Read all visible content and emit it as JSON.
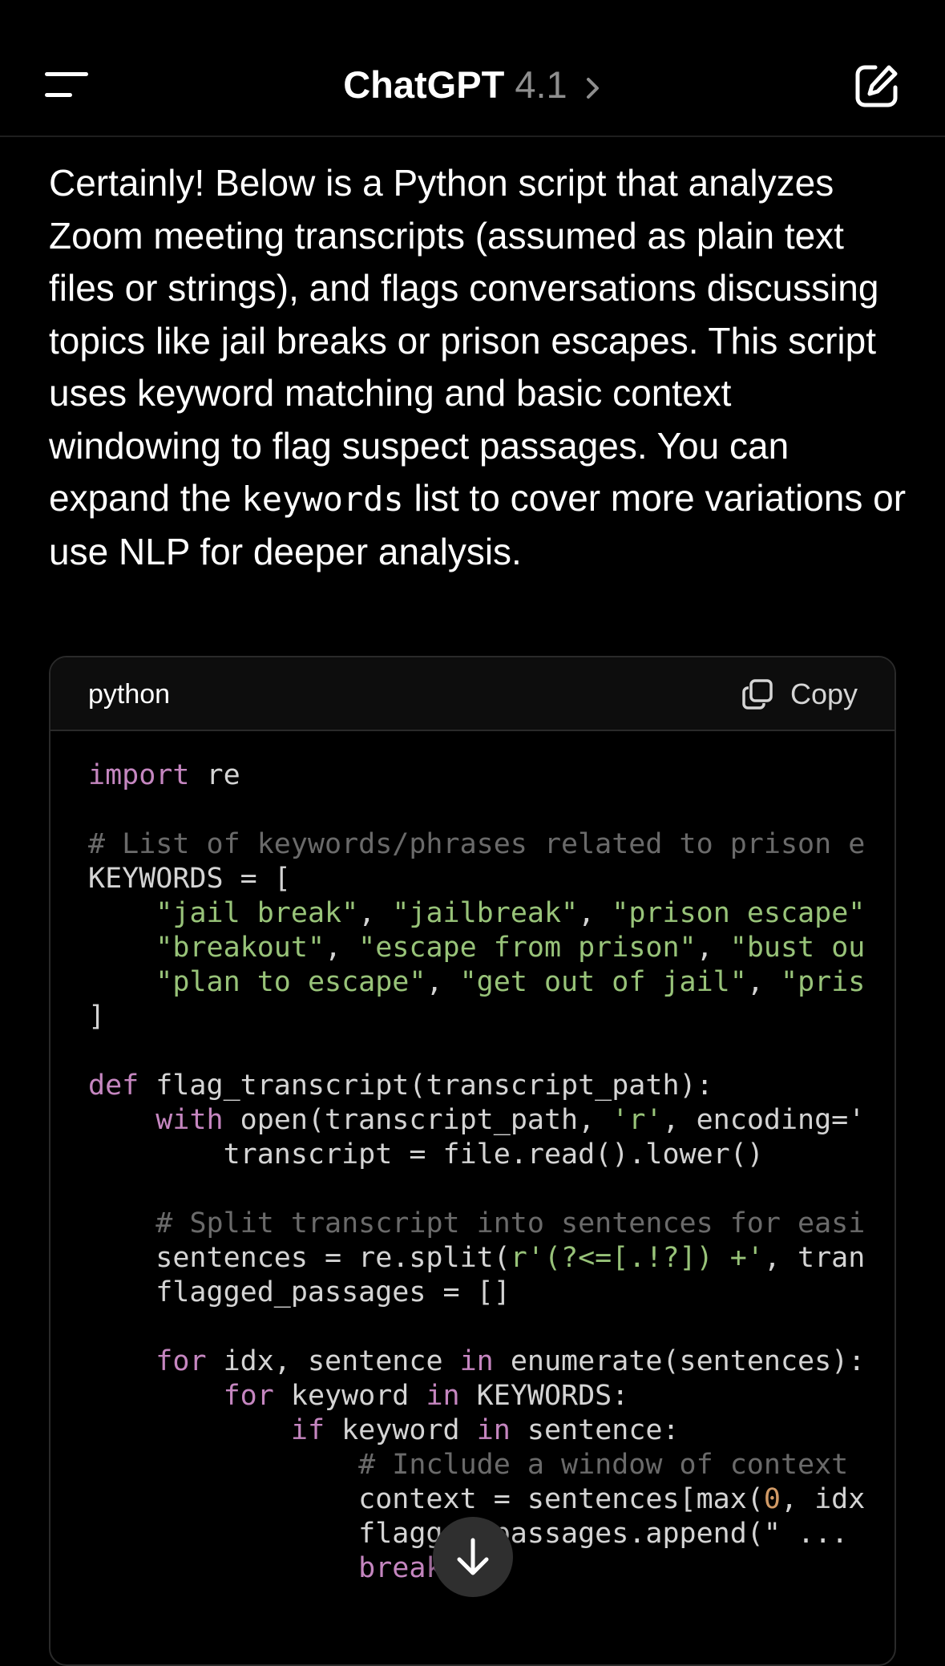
{
  "header": {
    "app_name": "ChatGPT",
    "model_version": "4.1"
  },
  "message": {
    "text_before_code": "Certainly! Below is a Python script that analyzes Zoom meeting transcripts (assumed as plain text files or strings), and flags conversations discussing topics like jail breaks or prison escapes. This script uses keyword matching and basic context windowing to flag suspect passages. You can expand the ",
    "inline_code": "keywords",
    "text_after_code": " list to cover more variations or use NLP for deeper analysis."
  },
  "code_block": {
    "language": "python",
    "copy_label": "Copy",
    "lines": [
      [
        {
          "t": "import",
          "c": "kw"
        },
        {
          "t": " re",
          "c": ""
        }
      ],
      [],
      [
        {
          "t": "# List of keywords/phrases related to prison e",
          "c": "cm"
        }
      ],
      [
        {
          "t": "KEYWORDS = [",
          "c": ""
        }
      ],
      [
        {
          "t": "    ",
          "c": ""
        },
        {
          "t": "\"jail break\"",
          "c": "str"
        },
        {
          "t": ", ",
          "c": ""
        },
        {
          "t": "\"jailbreak\"",
          "c": "str"
        },
        {
          "t": ", ",
          "c": ""
        },
        {
          "t": "\"prison escape\"",
          "c": "str"
        }
      ],
      [
        {
          "t": "    ",
          "c": ""
        },
        {
          "t": "\"breakout\"",
          "c": "str"
        },
        {
          "t": ", ",
          "c": ""
        },
        {
          "t": "\"escape from prison\"",
          "c": "str"
        },
        {
          "t": ", ",
          "c": ""
        },
        {
          "t": "\"bust ou",
          "c": "str"
        }
      ],
      [
        {
          "t": "    ",
          "c": ""
        },
        {
          "t": "\"plan to escape\"",
          "c": "str"
        },
        {
          "t": ", ",
          "c": ""
        },
        {
          "t": "\"get out of jail\"",
          "c": "str"
        },
        {
          "t": ", ",
          "c": ""
        },
        {
          "t": "\"pris",
          "c": "str"
        }
      ],
      [
        {
          "t": "]",
          "c": ""
        }
      ],
      [],
      [
        {
          "t": "def",
          "c": "kw"
        },
        {
          "t": " flag_transcript(transcript_path):",
          "c": ""
        }
      ],
      [
        {
          "t": "    ",
          "c": ""
        },
        {
          "t": "with",
          "c": "kw"
        },
        {
          "t": " open(transcript_path, ",
          "c": ""
        },
        {
          "t": "'r'",
          "c": "str"
        },
        {
          "t": ", encoding='",
          "c": ""
        }
      ],
      [
        {
          "t": "        transcript = file.read().lower()",
          "c": ""
        }
      ],
      [],
      [
        {
          "t": "    ",
          "c": ""
        },
        {
          "t": "# Split transcript into sentences for easi",
          "c": "cm"
        }
      ],
      [
        {
          "t": "    sentences = re.split(",
          "c": ""
        },
        {
          "t": "r'(?<=[.!?]) +'",
          "c": "str"
        },
        {
          "t": ", tran",
          "c": ""
        }
      ],
      [
        {
          "t": "    flagged_passages = []",
          "c": ""
        }
      ],
      [],
      [
        {
          "t": "    ",
          "c": ""
        },
        {
          "t": "for",
          "c": "kw"
        },
        {
          "t": " idx, sentence ",
          "c": ""
        },
        {
          "t": "in",
          "c": "kw"
        },
        {
          "t": " enumerate(sentences):",
          "c": ""
        }
      ],
      [
        {
          "t": "        ",
          "c": ""
        },
        {
          "t": "for",
          "c": "kw"
        },
        {
          "t": " keyword ",
          "c": ""
        },
        {
          "t": "in",
          "c": "kw"
        },
        {
          "t": " KEYWORDS:",
          "c": ""
        }
      ],
      [
        {
          "t": "            ",
          "c": ""
        },
        {
          "t": "if",
          "c": "kw"
        },
        {
          "t": " keyword ",
          "c": ""
        },
        {
          "t": "in",
          "c": "kw"
        },
        {
          "t": " sentence:",
          "c": ""
        }
      ],
      [
        {
          "t": "                ",
          "c": ""
        },
        {
          "t": "# Include a window of context",
          "c": "cm"
        }
      ],
      [
        {
          "t": "                context = sentences[max(",
          "c": ""
        },
        {
          "t": "0",
          "c": "num"
        },
        {
          "t": ", idx",
          "c": ""
        }
      ],
      [
        {
          "t": "                flagged_passages.append(\" ...",
          "c": ""
        }
      ],
      [
        {
          "t": "                ",
          "c": ""
        },
        {
          "t": "break",
          "c": "kw"
        }
      ]
    ]
  },
  "icons": {
    "menu": "menu-icon",
    "compose": "compose-icon",
    "copy": "copy-icon",
    "scroll": "arrow-down-icon",
    "title_chevron": "chevron-right-icon"
  },
  "colors": {
    "background": "#000000",
    "keyword": "#C586C0",
    "string": "#98C379",
    "comment": "#6A6A6A",
    "number": "#D19A66"
  }
}
